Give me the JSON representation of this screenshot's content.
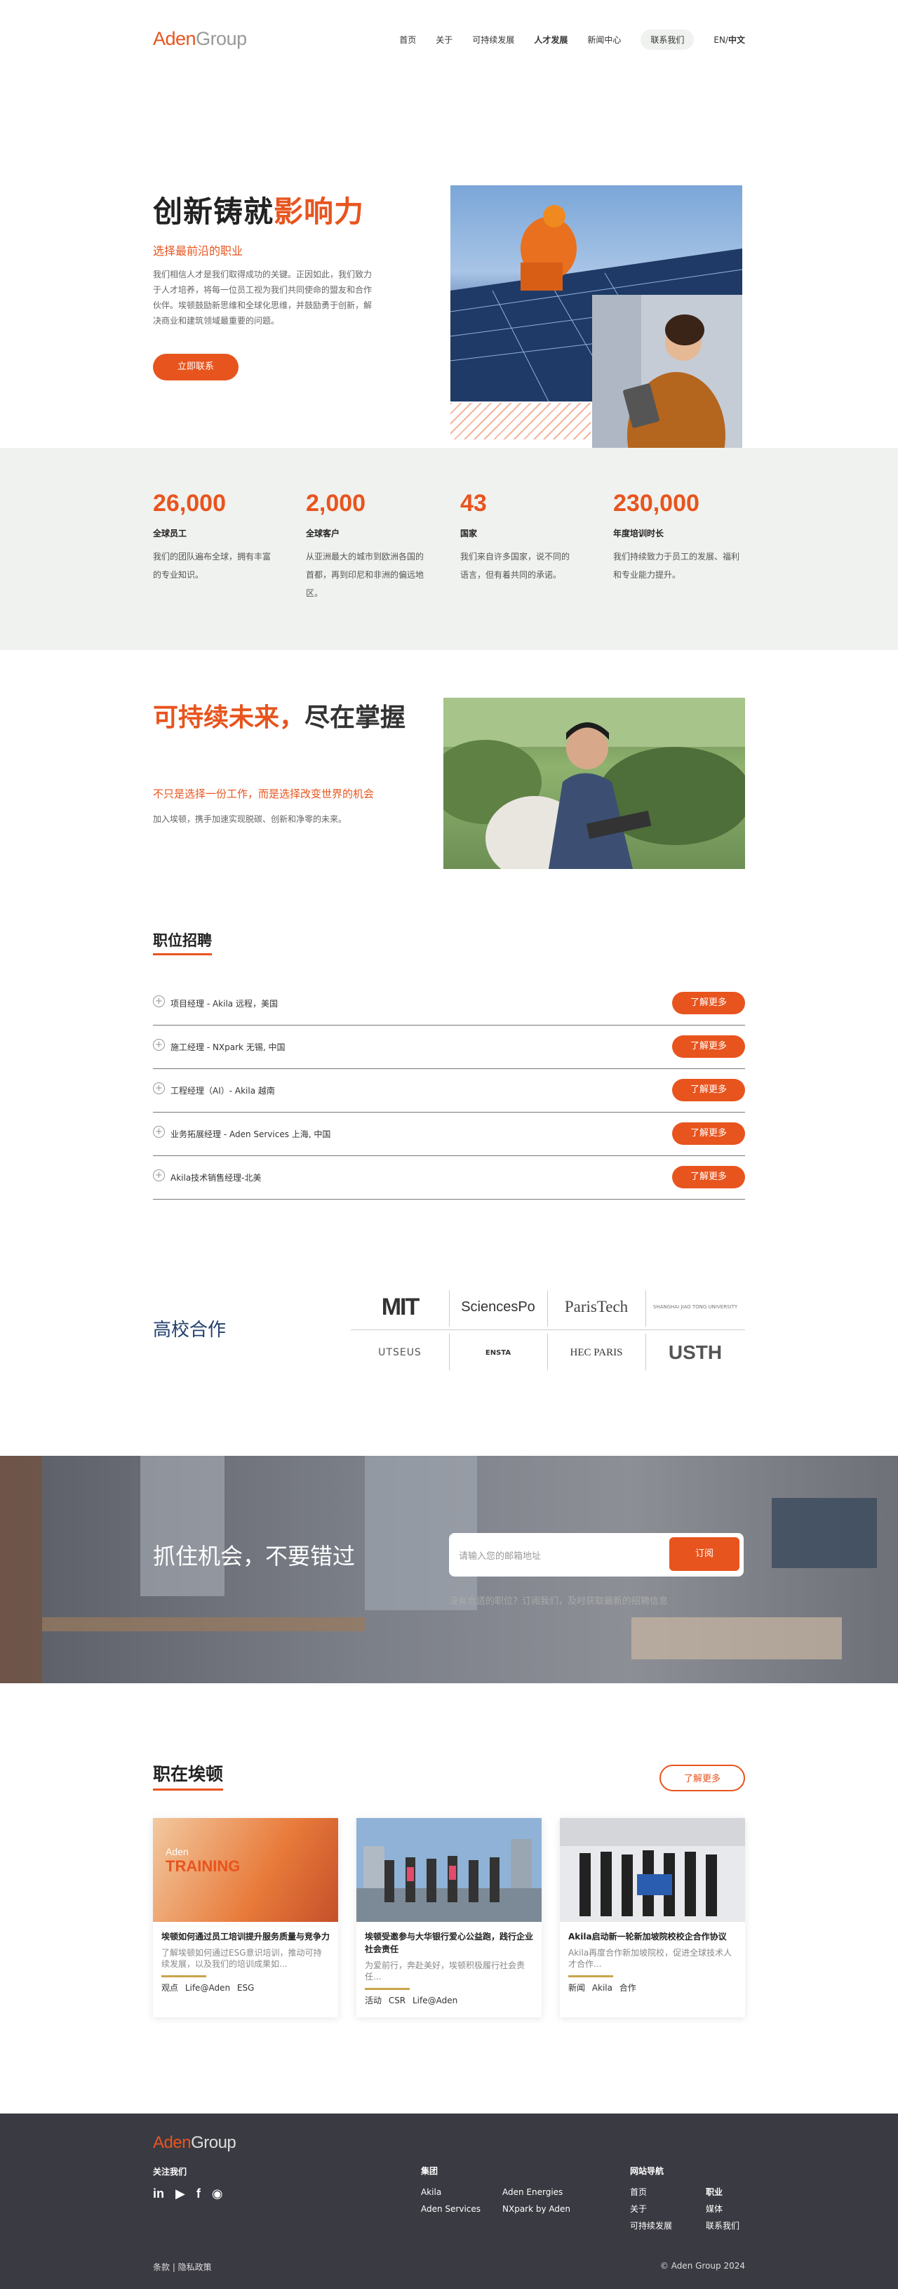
{
  "brand": {
    "logo_a": "Aden",
    "logo_b": "Group",
    "accent": "#e8541e"
  },
  "nav": {
    "items": [
      "首页",
      "关于",
      "可持续发展",
      "人才发展",
      "新闻中心"
    ],
    "contact": "联系我们",
    "lang_en": "EN/",
    "lang_cn": "中文"
  },
  "hero": {
    "title_black": "创新铸就",
    "title_orange": "影响力",
    "subtitle": "选择最前沿的职业",
    "desc": "我们相信人才是我们取得成功的关键。正因如此，我们致力于人才培养，将每一位员工视为我们共同使命的盟友和合作伙伴。埃顿鼓励新思维和全球化思维，并鼓励勇于创新，解决商业和建筑领域最重要的问题。",
    "button": "立即联系"
  },
  "stats": [
    {
      "num": "26,000",
      "label": "全球员工",
      "desc": "我们的团队遍布全球，拥有丰富的专业知识。"
    },
    {
      "num": "2,000",
      "label": "全球客户",
      "desc": "从亚洲最大的城市到欧洲各国的首都，再到印尼和非洲的偏远地区。"
    },
    {
      "num": "43",
      "label": "国家",
      "desc": "我们来自许多国家，说不同的语言，但有着共同的承诺。"
    },
    {
      "num": "230,000",
      "label": "年度培训时长",
      "desc": "我们持续致力于员工的发展、福利和专业能力提升。"
    }
  ],
  "sustain": {
    "title_orange": "可持续未来，",
    "title_black": "尽在掌握",
    "subtitle": "不只是选择一份工作，而是选择改变世界的机会",
    "desc": "加入埃顿，携手加速实现脱碳、创新和净零的未来。"
  },
  "jobs": {
    "title": "职位招聘",
    "button": "了解更多",
    "items": [
      "项目经理 - Akila 远程，美国",
      "施工经理 - NXpark 无锡, 中国",
      "工程经理（AI）- Akila 越南",
      "业务拓展经理 - Aden Services 上海, 中国",
      "Akila技术销售经理-北美"
    ]
  },
  "universities": {
    "title": "高校合作",
    "logos": [
      "MIT",
      "SciencesPo",
      "ParisTech",
      "SHANGHAI JIAO TONG UNIVERSITY",
      "UTSEUS",
      "ENSTA",
      "HEC PARIS",
      "USTH"
    ]
  },
  "cta": {
    "title": "抓住机会，不要错过",
    "placeholder": "请输入您的邮箱地址",
    "button": "订阅",
    "note": "没有合适的职位？订阅我们，及时获取最新的招聘信息"
  },
  "life": {
    "title": "职在埃顿",
    "more": "了解更多",
    "cards": [
      {
        "img_text_a": "Aden",
        "img_text_b": "TRAINING",
        "title": "埃顿如何通过员工培训提升服务质量与竞争力",
        "desc": "了解埃顿如何通过ESG意识培训，推动可持续发展，以及我们的培训成果如...",
        "tags": "观点 Life@Aden ESG"
      },
      {
        "title": "埃顿受邀参与大华银行爱心公益跑，践行企业社会责任",
        "desc": "为爱前行，奔赴美好，埃顿积极履行社会责任...",
        "tags": "活动 CSR Life@Aden"
      },
      {
        "title": "Akila启动新一轮新加坡院校校企合作协议",
        "desc": "Akila再度合作新加坡院校，促进全球技术人才合作...",
        "tags": "新闻 Akila 合作"
      }
    ]
  },
  "footer": {
    "follow": "关注我们",
    "group_title": "集团",
    "group_items": [
      "Akila",
      "Aden Services",
      "Aden Energies",
      "NXpark by Aden"
    ],
    "nav_title": "网站导航",
    "nav_col1": [
      "首页",
      "关于",
      "可持续发展"
    ],
    "nav_col2": [
      "职业",
      "媒体",
      "联系我们"
    ],
    "legal": "条款 | 隐私政策",
    "copyright": "© Aden Group 2024"
  }
}
